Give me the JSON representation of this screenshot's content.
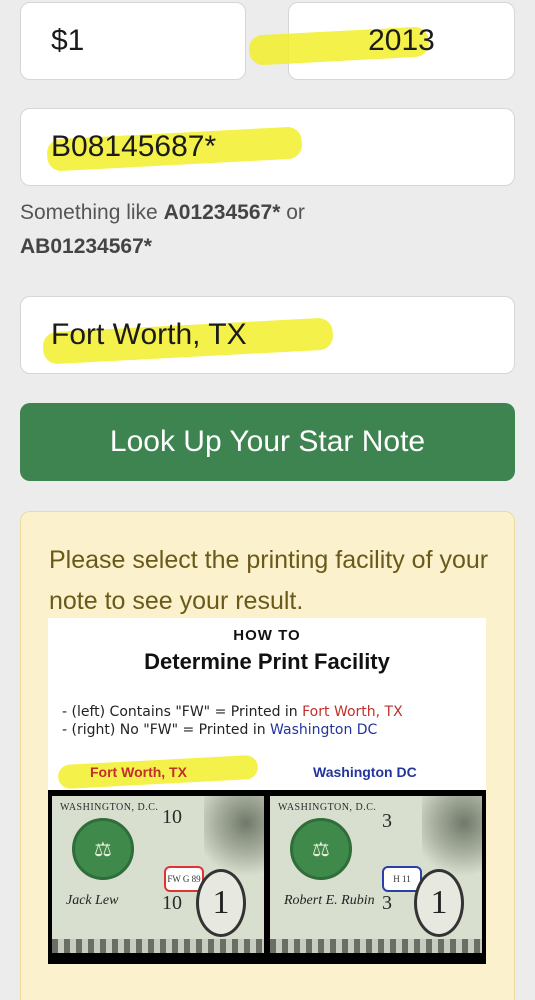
{
  "form": {
    "denomination": "$1",
    "year": "2013",
    "serial": "B08145687*",
    "serial_hint_prefix": "Something like",
    "serial_hint_ex1": "A01234567*",
    "serial_hint_or": "or",
    "serial_hint_ex2": "AB01234567*",
    "location": "Fort Worth, TX",
    "lookup_button": "Look Up Your Star Note"
  },
  "result": {
    "message": "Please select the printing facility of your note to see your result."
  },
  "howto_graphic": {
    "title_small": "HOW TO",
    "title_big": "Determine Print Facility",
    "line1_prefix": "- (left) Contains \"FW\" = Printed in",
    "line1_place": "Fort Worth, TX",
    "line2_prefix": "- (right) No \"FW\" = Printed in",
    "line2_place": "Washington DC",
    "label_left": "Fort Worth, TX",
    "label_right": "Washington DC",
    "left_bill": {
      "city": "WASHINGTON, D.C.",
      "number_top": "10",
      "number_bottom": "10",
      "plate": "FW G 89",
      "signature": "Jack Lew",
      "denomination": "1"
    },
    "right_bill": {
      "city": "WASHINGTON, D.C.",
      "number_top": "3",
      "number_bottom": "3",
      "plate": "H 11",
      "signature": "Robert E. Rubin",
      "denomination": "1"
    }
  },
  "colors": {
    "button_green": "#3e8450",
    "highlight_yellow": "#f2ee2c",
    "panel_bg": "#fbf1cc",
    "fort_worth_red": "#c0302a",
    "washington_blue": "#23359c"
  }
}
